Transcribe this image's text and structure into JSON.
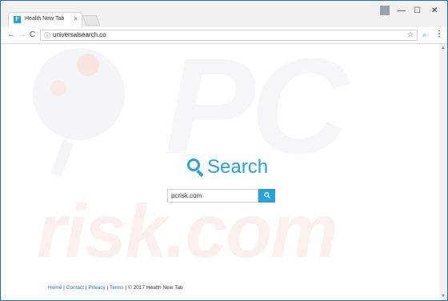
{
  "browser": {
    "tab": {
      "favicon": "F",
      "title": "Health New Tab",
      "close": "×"
    },
    "window_controls": {
      "minimize": "—",
      "maximize": "☐",
      "close": "✕"
    },
    "nav": {
      "back": "←",
      "forward": "→",
      "reload": "C"
    },
    "url": "universalsearch.co",
    "bookmark_star": "☆",
    "extension_icon": "⌕",
    "menu": "⋮"
  },
  "page": {
    "logo_text": "Search",
    "search": {
      "value": "pcrisk.com",
      "button_icon": "search-icon"
    },
    "footer": {
      "links": [
        "Home",
        "Contact",
        "Privacy",
        "Terms"
      ],
      "separator": "|",
      "copyright": "© 2017 Health New Tab"
    }
  },
  "colors": {
    "accent": "#2aa1d8",
    "link": "#1f6fb8"
  }
}
